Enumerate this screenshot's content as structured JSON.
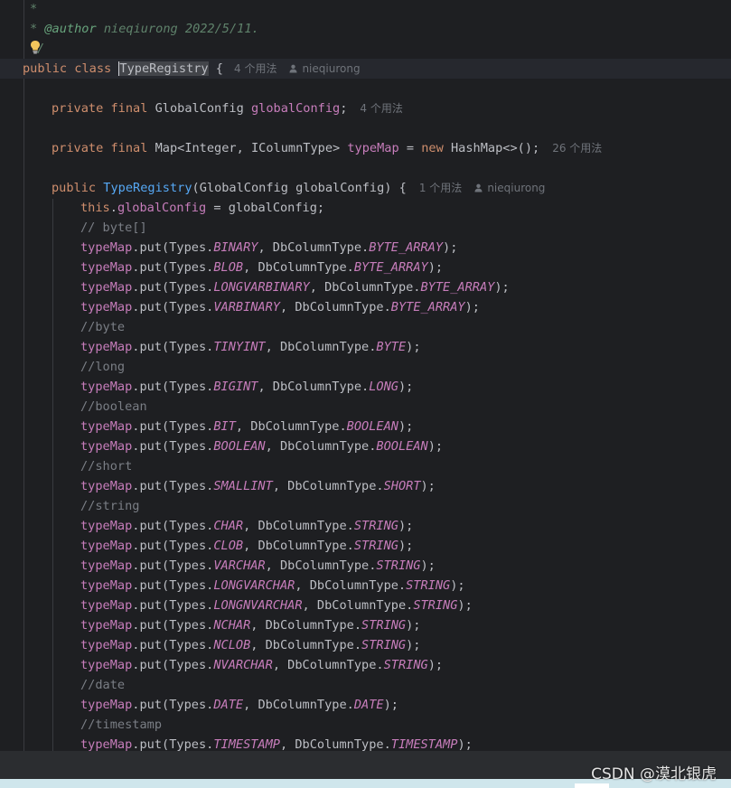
{
  "colors": {
    "background": "#1e1f22",
    "keyword": "#cf8e6d",
    "field": "#c77dbb",
    "method": "#56a8f5",
    "comment": "#7a7e85",
    "doc_comment": "#5f826b",
    "hint": "#6f737a"
  },
  "icons": [
    "lightbulb-icon",
    "user-icon"
  ],
  "code": {
    "line1": "*",
    "line2": {
      "star": "* ",
      "tag": "@author",
      "text": " nieqiurong 2022/5/11."
    },
    "line3": "/",
    "line4": {
      "kw": "public class ",
      "name": "TypeRegistry",
      "rest": " {",
      "usages": "4 个用法",
      "author": "nieqiurong"
    },
    "line6": {
      "kw": "private final ",
      "type": "GlobalConfig ",
      "field": "globalConfig",
      "rest": ";",
      "usages": "4 个用法"
    },
    "line8": {
      "kw": "private final ",
      "type": "Map<Integer, IColumnType> ",
      "field": "typeMap",
      "eq": " = ",
      "kw2": "new ",
      "rest": "HashMap<>();",
      "usages": "26 个用法"
    },
    "line10": {
      "kw": "public ",
      "name": "TypeRegistry",
      "rest": "(GlobalConfig globalConfig) {",
      "usages": "1 个用法",
      "author": "nieqiurong"
    },
    "line11": {
      "kw": "this",
      "dot": ".",
      "field": "globalConfig",
      "rest": " = globalConfig;"
    },
    "comments": {
      "byte_array": "// byte[]",
      "byte": "//byte",
      "long": "//long",
      "boolean": "//boolean",
      "short": "//short",
      "string": "//string",
      "date": "//date",
      "timestamp": "//timestamp"
    },
    "put_lines": [
      {
        "field": "typeMap",
        "a": ".put(Types.",
        "const1": "BINARY",
        "b": ", DbColumnType.",
        "const2": "BYTE_ARRAY",
        "c": ");"
      },
      {
        "field": "typeMap",
        "a": ".put(Types.",
        "const1": "BLOB",
        "b": ", DbColumnType.",
        "const2": "BYTE_ARRAY",
        "c": ");"
      },
      {
        "field": "typeMap",
        "a": ".put(Types.",
        "const1": "LONGVARBINARY",
        "b": ", DbColumnType.",
        "const2": "BYTE_ARRAY",
        "c": ");"
      },
      {
        "field": "typeMap",
        "a": ".put(Types.",
        "const1": "VARBINARY",
        "b": ", DbColumnType.",
        "const2": "BYTE_ARRAY",
        "c": ");"
      },
      {
        "field": "typeMap",
        "a": ".put(Types.",
        "const1": "TINYINT",
        "b": ", DbColumnType.",
        "const2": "BYTE",
        "c": ");"
      },
      {
        "field": "typeMap",
        "a": ".put(Types.",
        "const1": "BIGINT",
        "b": ", DbColumnType.",
        "const2": "LONG",
        "c": ");"
      },
      {
        "field": "typeMap",
        "a": ".put(Types.",
        "const1": "BIT",
        "b": ", DbColumnType.",
        "const2": "BOOLEAN",
        "c": ");"
      },
      {
        "field": "typeMap",
        "a": ".put(Types.",
        "const1": "BOOLEAN",
        "b": ", DbColumnType.",
        "const2": "BOOLEAN",
        "c": ");"
      },
      {
        "field": "typeMap",
        "a": ".put(Types.",
        "const1": "SMALLINT",
        "b": ", DbColumnType.",
        "const2": "SHORT",
        "c": ");"
      },
      {
        "field": "typeMap",
        "a": ".put(Types.",
        "const1": "CHAR",
        "b": ", DbColumnType.",
        "const2": "STRING",
        "c": ");"
      },
      {
        "field": "typeMap",
        "a": ".put(Types.",
        "const1": "CLOB",
        "b": ", DbColumnType.",
        "const2": "STRING",
        "c": ");"
      },
      {
        "field": "typeMap",
        "a": ".put(Types.",
        "const1": "VARCHAR",
        "b": ", DbColumnType.",
        "const2": "STRING",
        "c": ");"
      },
      {
        "field": "typeMap",
        "a": ".put(Types.",
        "const1": "LONGVARCHAR",
        "b": ", DbColumnType.",
        "const2": "STRING",
        "c": ");"
      },
      {
        "field": "typeMap",
        "a": ".put(Types.",
        "const1": "LONGNVARCHAR",
        "b": ", DbColumnType.",
        "const2": "STRING",
        "c": ");"
      },
      {
        "field": "typeMap",
        "a": ".put(Types.",
        "const1": "NCHAR",
        "b": ", DbColumnType.",
        "const2": "STRING",
        "c": ");"
      },
      {
        "field": "typeMap",
        "a": ".put(Types.",
        "const1": "NCLOB",
        "b": ", DbColumnType.",
        "const2": "STRING",
        "c": ");"
      },
      {
        "field": "typeMap",
        "a": ".put(Types.",
        "const1": "NVARCHAR",
        "b": ", DbColumnType.",
        "const2": "STRING",
        "c": ");"
      },
      {
        "field": "typeMap",
        "a": ".put(Types.",
        "const1": "DATE",
        "b": ", DbColumnType.",
        "const2": "DATE",
        "c": ");"
      },
      {
        "field": "typeMap",
        "a": ".put(Types.",
        "const1": "TIMESTAMP",
        "b": ", DbColumnType.",
        "const2": "TIMESTAMP",
        "c": ");"
      }
    ]
  },
  "watermark": "CSDN @漠北银虎"
}
